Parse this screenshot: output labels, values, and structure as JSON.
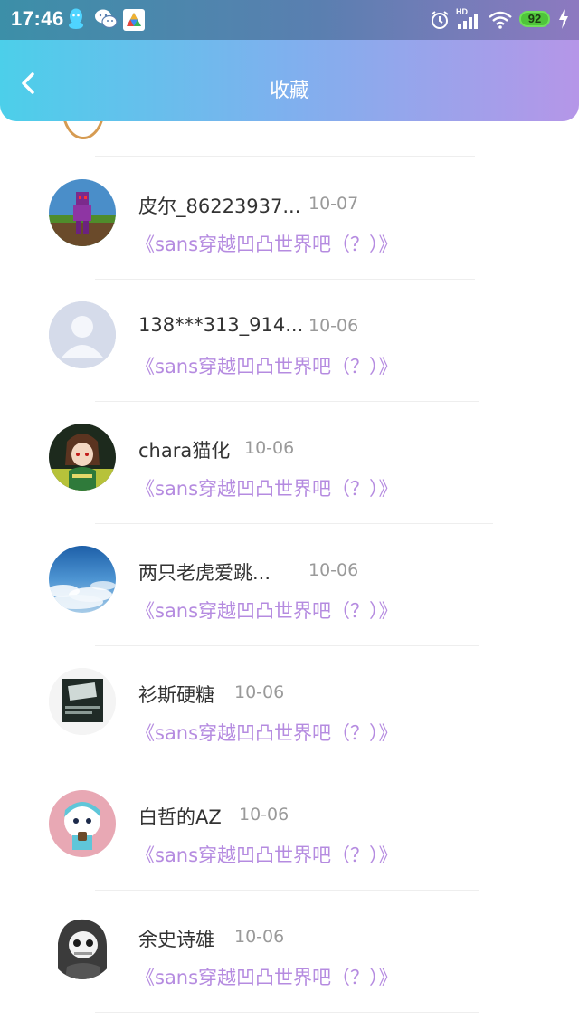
{
  "status_bar": {
    "time": "17:46",
    "network_label": "HD",
    "battery": "92"
  },
  "header": {
    "title": "收藏"
  },
  "favorites": [
    {
      "name": "皮尔_86223937...",
      "date": "10-07",
      "post": "《sans穿越凹凸世界吧（？）》"
    },
    {
      "name": "138***313_914...",
      "date": "10-06",
      "post": "《sans穿越凹凸世界吧（？）》"
    },
    {
      "name": "chara猫化",
      "date": "10-06",
      "post": "《sans穿越凹凸世界吧（？）》"
    },
    {
      "name": "两只老虎爱跳...",
      "date": "10-06",
      "post": "《sans穿越凹凸世界吧（？）》"
    },
    {
      "name": "衫斯硬糖",
      "date": "10-06",
      "post": "《sans穿越凹凸世界吧（？）》"
    },
    {
      "name": "白哲的AZ",
      "date": "10-06",
      "post": "《sans穿越凹凸世界吧（？）》"
    },
    {
      "name": "余史诗雄",
      "date": "10-06",
      "post": "《sans穿越凹凸世界吧（？）》"
    }
  ],
  "colors": {
    "accent_text": "#b58be0",
    "header_gradient_start": "#4ccfea",
    "header_gradient_end": "#b596e8"
  }
}
